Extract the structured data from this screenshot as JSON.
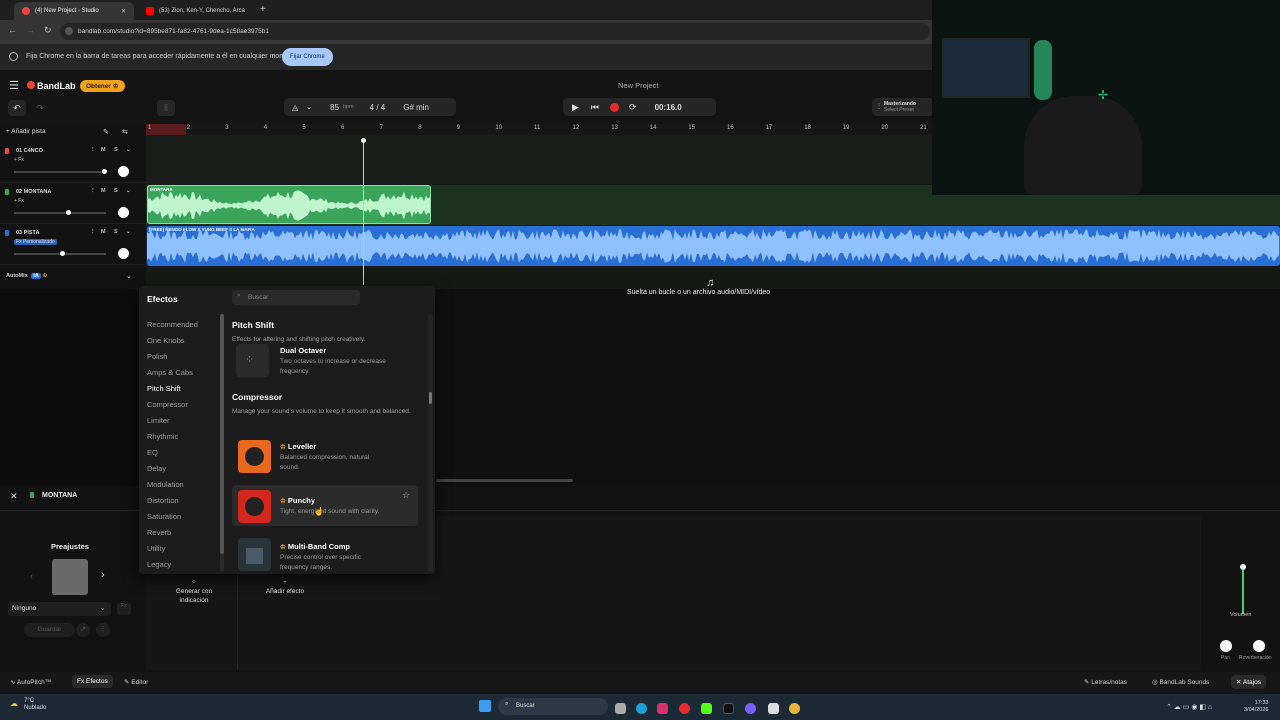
{
  "browser": {
    "tabs": [
      {
        "title": "(4) New Project - Studio"
      },
      {
        "title": "(53) Zion, Ken-Y, Chencho, Arca"
      }
    ],
    "url": "bandlab.com/studio?id=895be871-fa82-4761-9dea-1c58ae3975b1",
    "infobar_text": "Fija Chrome en la barra de tareas para acceder rápidamente a él en cualquier momento",
    "infobar_button": "Fijar Chrome"
  },
  "app": {
    "logo": "BandLab",
    "obtener": "Obtener",
    "project_title": "New Project",
    "bpm": "85",
    "bpm_unit": "bpm",
    "time_sig": "4 / 4",
    "key": "G# min",
    "time": "00:16.0",
    "mastering_title": "Masterizando",
    "mastering_sub": "Select Preset"
  },
  "ruler": [
    "1",
    "2",
    "3",
    "4",
    "5",
    "6",
    "7",
    "8",
    "9",
    "10",
    "11",
    "12",
    "13",
    "14",
    "15",
    "16",
    "17",
    "18",
    "19",
    "20",
    "21"
  ],
  "tracks": {
    "add_label": "Añadir pista",
    "items": [
      {
        "name": "01  C4NCO",
        "fx": "+ Fx"
      },
      {
        "name": "02  MONTANA",
        "fx": "+ Fx"
      },
      {
        "name": "03  PISTA",
        "fx": "Fx Personalizado"
      }
    ],
    "m_label": "M",
    "s_label": "S",
    "automix": "AutoMix",
    "automix_badge": "IA"
  },
  "clips": {
    "montana": "MONTANA",
    "pista": "[FREE] ÑENGO FLOW X YUNG BEEF X LA MAFIA"
  },
  "drop_text": "Suelta un bucle o un archivo audio/MIDI/vídeo",
  "effects": {
    "title": "Efectos",
    "search_placeholder": "Buscar",
    "categories": [
      "Recommended",
      "One Knobs",
      "Polish",
      "Amps & Cabs",
      "Pitch Shift",
      "Compressor",
      "Limiter",
      "Rhythmic",
      "EQ",
      "Delay",
      "Modulation",
      "Distortion",
      "Saturation",
      "Reverb",
      "Utility",
      "Legacy"
    ],
    "sections": [
      {
        "title": "Pitch Shift",
        "desc": "Effects for altering and shifting pitch creatively."
      },
      {
        "title": "Compressor",
        "desc": "Manage your sound's volume to keep it smooth and balanced."
      }
    ],
    "items": [
      {
        "name": "Dual Octaver",
        "desc": "Two octaves to increase or decrease frequency."
      },
      {
        "name": "Leveller",
        "desc": "Balanced compression, natural sound."
      },
      {
        "name": "Punchy",
        "desc": "Tight, energized sound with clarity."
      },
      {
        "name": "Multi-Band Comp",
        "desc": "Precise control over specific frequency ranges."
      }
    ]
  },
  "bottom": {
    "track_name": "MONTANA",
    "presets_label": "Preajustes",
    "preset_value": "Ninguno",
    "save": "Guardar",
    "generate": "Generar con indicación",
    "add_effect": "Añadir efecto",
    "volume": "Volumen",
    "pan": "Pan",
    "reverb": "Reverberación"
  },
  "footer": {
    "autopitch": "AutoPitch™",
    "effects": "Efectos",
    "editor": "Editor",
    "lyrics": "Letras/notas",
    "sounds": "BandLab Sounds",
    "shortcuts": "Atajos"
  },
  "taskbar": {
    "weather_temp": "7°C",
    "weather_desc": "Nublado",
    "search": "Buscar",
    "clock": "17:33",
    "date": "3/04/2026"
  },
  "colors": {
    "accent": "#f0a31a",
    "green_clip": "#3aa55a",
    "blue_clip": "#2a6fd6",
    "record": "#e52b2b"
  }
}
